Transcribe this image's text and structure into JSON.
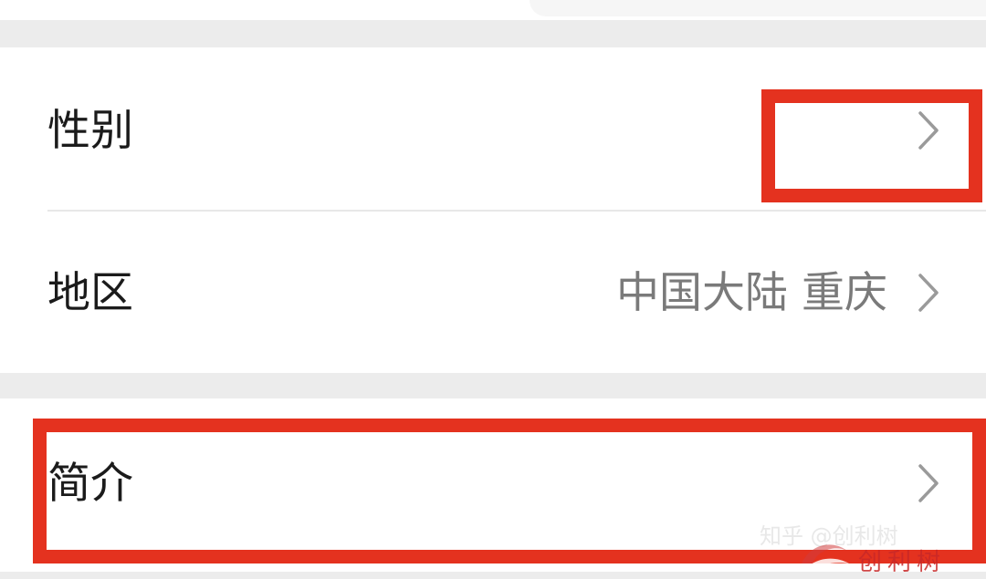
{
  "settings": {
    "rows": [
      {
        "label": "性别",
        "value": ""
      },
      {
        "label": "地区",
        "value": "中国大陆 重庆"
      },
      {
        "label": "简介",
        "value": ""
      }
    ]
  },
  "watermark": {
    "top_text": "知乎 @创利树",
    "brand_text": "创利树"
  },
  "colors": {
    "highlight": "#e4321f",
    "background": "#ececec",
    "card": "#ffffff",
    "value_text": "#7a7a7a"
  },
  "icons": {
    "row_arrow": "chevron-right-icon"
  }
}
